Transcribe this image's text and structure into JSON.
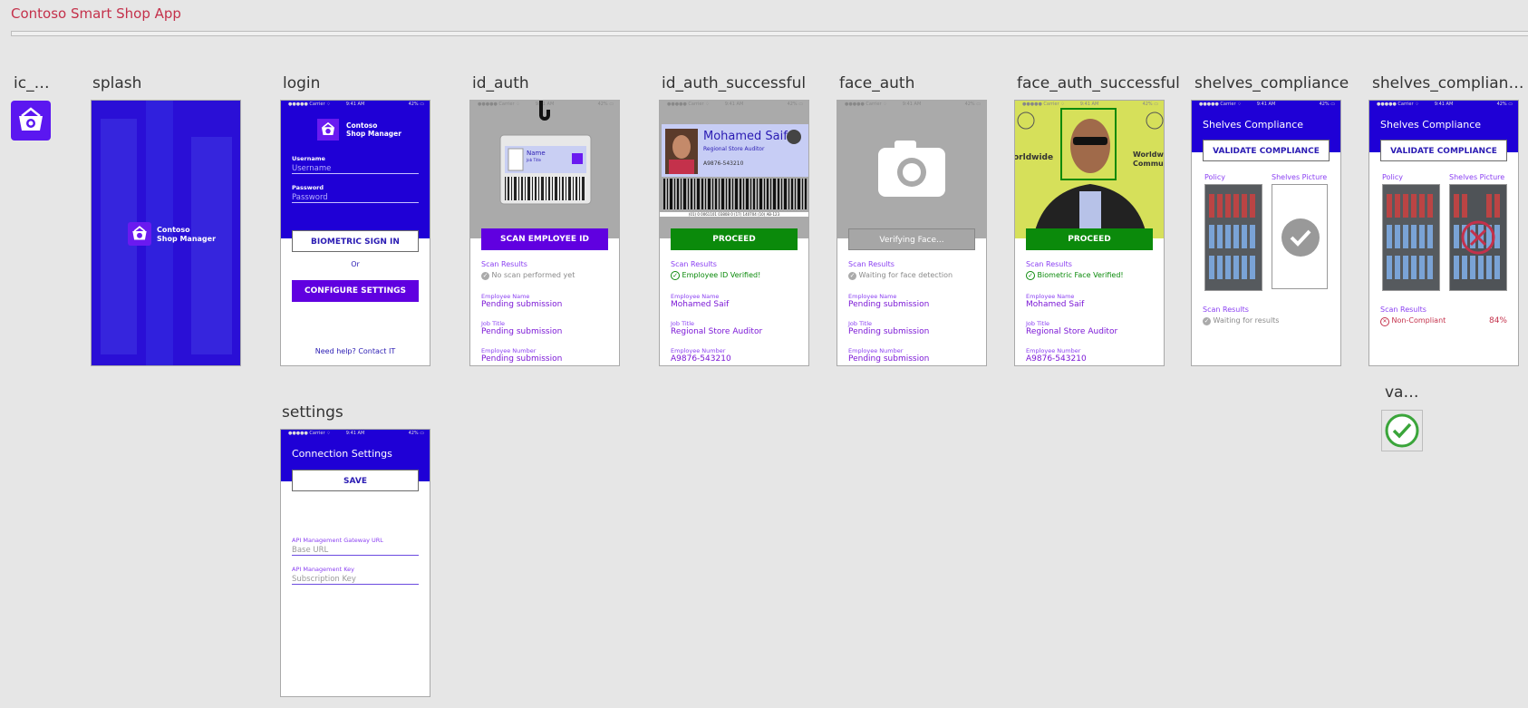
{
  "app_title": "Contoso Smart Shop App",
  "status_bar": {
    "carrier": "●●●●● Carrier ♢",
    "time": "9:41 AM",
    "battery": "42% ▭"
  },
  "screens": {
    "ic_app": {
      "label": "ic_a..."
    },
    "splash": {
      "label": "splash",
      "brand_line1": "Contoso",
      "brand_line2": "Shop Manager"
    },
    "login": {
      "label": "login",
      "brand_line1": "Contoso",
      "brand_line2": "Shop Manager",
      "username_label": "Username",
      "username_placeholder": "Username",
      "password_label": "Password",
      "password_placeholder": "Password",
      "biometric_button": "BIOMETRIC SIGN IN",
      "or_text": "Or",
      "configure_button": "CONFIGURE SETTINGS",
      "help_text": "Need help?",
      "help_link": "Contact IT"
    },
    "settings": {
      "label": "settings",
      "header": "Connection Settings",
      "save_button": "SAVE",
      "gateway_label": "API Management Gateway URL",
      "gateway_placeholder": "Base URL",
      "key_label": "API Management Key",
      "key_placeholder": "Subscription Key"
    },
    "id_auth": {
      "label": "id_auth",
      "card_name": "Name",
      "card_title": "Job Title",
      "scan_button": "SCAN EMPLOYEE ID",
      "scan_results_label": "Scan Results",
      "scan_status": "No scan performed yet",
      "employee_name_label": "Employee Name",
      "employee_name": "Pending submission",
      "job_title_label": "Job Title",
      "job_title": "Pending submission",
      "employee_number_label": "Employee Number",
      "employee_number": "Pending submission"
    },
    "id_auth_successful": {
      "label": "id_auth_successful",
      "card_name": "Mohamed Saif",
      "card_title": "Regional Store Auditor",
      "card_number": "A9876-543210",
      "barcode_text": "(01) 0 0061101 03808 0 (17) 140704 (10) AB-123",
      "proceed_button": "PROCEED",
      "scan_results_label": "Scan Results",
      "scan_status": "Employee ID Verified!",
      "employee_name_label": "Employee Name",
      "employee_name": "Mohamed Saif",
      "job_title_label": "Job Title",
      "job_title": "Regional Store Auditor",
      "employee_number_label": "Employee Number",
      "employee_number": "A9876-543210"
    },
    "face_auth": {
      "label": "face_auth",
      "verify_button": "Verifying Face...",
      "scan_results_label": "Scan Results",
      "scan_status": "Waiting for face detection",
      "employee_name_label": "Employee Name",
      "employee_name": "Pending submission",
      "job_title_label": "Job Title",
      "job_title": "Pending submission",
      "employee_number_label": "Employee Number",
      "employee_number": "Pending submission"
    },
    "face_auth_successful": {
      "label": "face_auth_successful",
      "bg_text_left": "orldwide",
      "bg_text_right": "Worldw Commu",
      "proceed_button": "PROCEED",
      "scan_results_label": "Scan Results",
      "scan_status": "Biometric Face Verified!",
      "employee_name_label": "Employee Name",
      "employee_name": "Mohamed Saif",
      "job_title_label": "Job Title",
      "job_title": "Regional Store Auditor",
      "employee_number_label": "Employee Number",
      "employee_number": "A9876-543210"
    },
    "shelves_compliance": {
      "label": "shelves_compliance",
      "header": "Shelves Compliance",
      "validate_button": "VALIDATE COMPLIANCE",
      "policy_label": "Policy",
      "picture_label": "Shelves Picture",
      "scan_results_label": "Scan Results",
      "scan_status": "Waiting for results"
    },
    "shelves_compliance_fail": {
      "label": "shelves_compliance_f...",
      "header": "Shelves Compliance",
      "validate_button": "VALIDATE COMPLIANCE",
      "policy_label": "Policy",
      "picture_label": "Shelves Picture",
      "scan_results_label": "Scan Results",
      "scan_status": "Non-Compliant",
      "score": "84%"
    },
    "validated_icon": {
      "label": "vali..."
    }
  },
  "colors": {
    "brand_blue": "#1f00d6",
    "purple": "#6000e0",
    "green": "#0b8a0b",
    "red": "#c4314b"
  }
}
